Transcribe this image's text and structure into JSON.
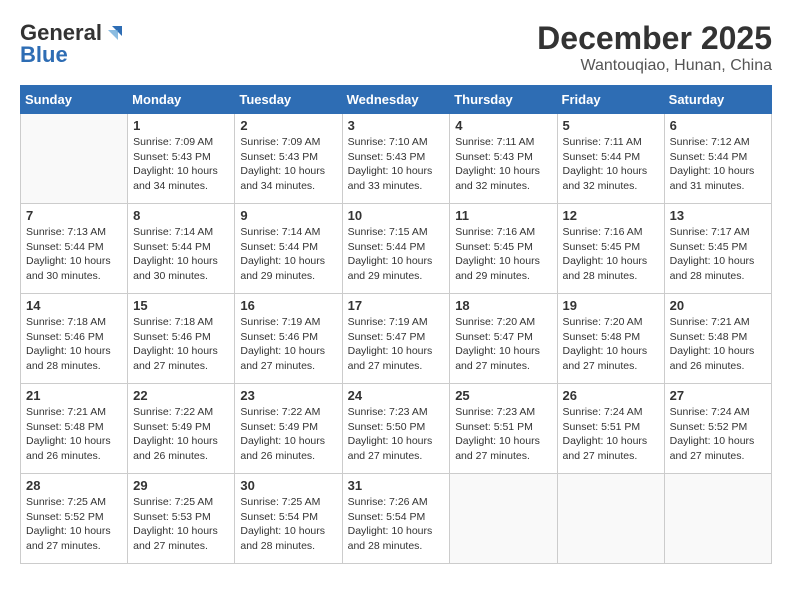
{
  "header": {
    "logo_general": "General",
    "logo_blue": "Blue",
    "month_title": "December 2025",
    "location": "Wantouqiao, Hunan, China"
  },
  "days_of_week": [
    "Sunday",
    "Monday",
    "Tuesday",
    "Wednesday",
    "Thursday",
    "Friday",
    "Saturday"
  ],
  "weeks": [
    [
      {
        "day": "",
        "info": ""
      },
      {
        "day": "1",
        "info": "Sunrise: 7:09 AM\nSunset: 5:43 PM\nDaylight: 10 hours\nand 34 minutes."
      },
      {
        "day": "2",
        "info": "Sunrise: 7:09 AM\nSunset: 5:43 PM\nDaylight: 10 hours\nand 34 minutes."
      },
      {
        "day": "3",
        "info": "Sunrise: 7:10 AM\nSunset: 5:43 PM\nDaylight: 10 hours\nand 33 minutes."
      },
      {
        "day": "4",
        "info": "Sunrise: 7:11 AM\nSunset: 5:43 PM\nDaylight: 10 hours\nand 32 minutes."
      },
      {
        "day": "5",
        "info": "Sunrise: 7:11 AM\nSunset: 5:44 PM\nDaylight: 10 hours\nand 32 minutes."
      },
      {
        "day": "6",
        "info": "Sunrise: 7:12 AM\nSunset: 5:44 PM\nDaylight: 10 hours\nand 31 minutes."
      }
    ],
    [
      {
        "day": "7",
        "info": "Sunrise: 7:13 AM\nSunset: 5:44 PM\nDaylight: 10 hours\nand 30 minutes."
      },
      {
        "day": "8",
        "info": "Sunrise: 7:14 AM\nSunset: 5:44 PM\nDaylight: 10 hours\nand 30 minutes."
      },
      {
        "day": "9",
        "info": "Sunrise: 7:14 AM\nSunset: 5:44 PM\nDaylight: 10 hours\nand 29 minutes."
      },
      {
        "day": "10",
        "info": "Sunrise: 7:15 AM\nSunset: 5:44 PM\nDaylight: 10 hours\nand 29 minutes."
      },
      {
        "day": "11",
        "info": "Sunrise: 7:16 AM\nSunset: 5:45 PM\nDaylight: 10 hours\nand 29 minutes."
      },
      {
        "day": "12",
        "info": "Sunrise: 7:16 AM\nSunset: 5:45 PM\nDaylight: 10 hours\nand 28 minutes."
      },
      {
        "day": "13",
        "info": "Sunrise: 7:17 AM\nSunset: 5:45 PM\nDaylight: 10 hours\nand 28 minutes."
      }
    ],
    [
      {
        "day": "14",
        "info": "Sunrise: 7:18 AM\nSunset: 5:46 PM\nDaylight: 10 hours\nand 28 minutes."
      },
      {
        "day": "15",
        "info": "Sunrise: 7:18 AM\nSunset: 5:46 PM\nDaylight: 10 hours\nand 27 minutes."
      },
      {
        "day": "16",
        "info": "Sunrise: 7:19 AM\nSunset: 5:46 PM\nDaylight: 10 hours\nand 27 minutes."
      },
      {
        "day": "17",
        "info": "Sunrise: 7:19 AM\nSunset: 5:47 PM\nDaylight: 10 hours\nand 27 minutes."
      },
      {
        "day": "18",
        "info": "Sunrise: 7:20 AM\nSunset: 5:47 PM\nDaylight: 10 hours\nand 27 minutes."
      },
      {
        "day": "19",
        "info": "Sunrise: 7:20 AM\nSunset: 5:48 PM\nDaylight: 10 hours\nand 27 minutes."
      },
      {
        "day": "20",
        "info": "Sunrise: 7:21 AM\nSunset: 5:48 PM\nDaylight: 10 hours\nand 26 minutes."
      }
    ],
    [
      {
        "day": "21",
        "info": "Sunrise: 7:21 AM\nSunset: 5:48 PM\nDaylight: 10 hours\nand 26 minutes."
      },
      {
        "day": "22",
        "info": "Sunrise: 7:22 AM\nSunset: 5:49 PM\nDaylight: 10 hours\nand 26 minutes."
      },
      {
        "day": "23",
        "info": "Sunrise: 7:22 AM\nSunset: 5:49 PM\nDaylight: 10 hours\nand 26 minutes."
      },
      {
        "day": "24",
        "info": "Sunrise: 7:23 AM\nSunset: 5:50 PM\nDaylight: 10 hours\nand 27 minutes."
      },
      {
        "day": "25",
        "info": "Sunrise: 7:23 AM\nSunset: 5:51 PM\nDaylight: 10 hours\nand 27 minutes."
      },
      {
        "day": "26",
        "info": "Sunrise: 7:24 AM\nSunset: 5:51 PM\nDaylight: 10 hours\nand 27 minutes."
      },
      {
        "day": "27",
        "info": "Sunrise: 7:24 AM\nSunset: 5:52 PM\nDaylight: 10 hours\nand 27 minutes."
      }
    ],
    [
      {
        "day": "28",
        "info": "Sunrise: 7:25 AM\nSunset: 5:52 PM\nDaylight: 10 hours\nand 27 minutes."
      },
      {
        "day": "29",
        "info": "Sunrise: 7:25 AM\nSunset: 5:53 PM\nDaylight: 10 hours\nand 27 minutes."
      },
      {
        "day": "30",
        "info": "Sunrise: 7:25 AM\nSunset: 5:54 PM\nDaylight: 10 hours\nand 28 minutes."
      },
      {
        "day": "31",
        "info": "Sunrise: 7:26 AM\nSunset: 5:54 PM\nDaylight: 10 hours\nand 28 minutes."
      },
      {
        "day": "",
        "info": ""
      },
      {
        "day": "",
        "info": ""
      },
      {
        "day": "",
        "info": ""
      }
    ]
  ]
}
